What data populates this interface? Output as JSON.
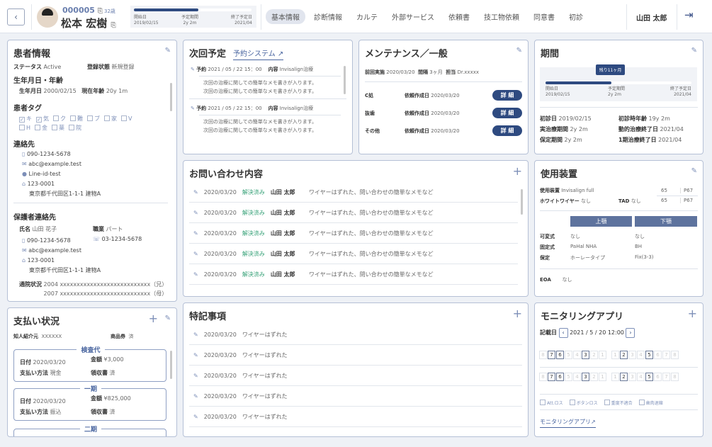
{
  "header": {
    "back": "‹",
    "patient_id": "000005",
    "age": "32歳",
    "name": "松本 宏樹",
    "progress": {
      "fraction": 0.55,
      "start_label": "開始日",
      "start": "2019/02/15",
      "period_label": "予定期間",
      "period": "2y 2m",
      "end_label": "終了予定日",
      "end": "2021/04"
    },
    "tabs": [
      "基本情報",
      "診断情報",
      "カルテ",
      "外部サービス",
      "依頼書",
      "技工物依頼",
      "同意書",
      "初診"
    ],
    "active_tab": "基本情報",
    "user": "山田 太郎"
  },
  "patient": {
    "title": "患者情報",
    "status_label": "ステータス",
    "status": "Active",
    "reg_label": "登録状態",
    "reg": "新規登録",
    "birth_title": "生年月日・年齢",
    "birth_label": "生年月日",
    "birth": "2000/02/15",
    "age_label": "現在年齢",
    "age": "20y 1m",
    "tags_title": "患者タグ",
    "tags": [
      {
        "label": "キ",
        "checked": true
      },
      {
        "label": "気",
        "checked": true
      },
      {
        "label": "ク",
        "checked": false
      },
      {
        "label": "難",
        "checked": false
      },
      {
        "label": "ブ",
        "checked": false
      },
      {
        "label": "家",
        "checked": false
      },
      {
        "label": "V",
        "checked": false
      },
      {
        "label": "H",
        "checked": false
      },
      {
        "label": "金",
        "checked": false
      },
      {
        "label": "薬",
        "checked": false
      },
      {
        "label": "院",
        "checked": false
      }
    ],
    "contact_title": "連絡先",
    "phone": "090-1234-5678",
    "email": "abc@example.test",
    "line": "Line-id-test",
    "zip": "123-0001",
    "address": "東京都千代田区1-1-1 建物A",
    "guardian_title": "保護者連絡先",
    "g_name_label": "氏名",
    "g_name": "山田 花子",
    "g_job_label": "職業",
    "g_job": "パート",
    "g_phone": "090-1234-5678",
    "g_tel": "03-1234-5678",
    "g_email": "abc@example.test",
    "g_zip": "123-0001",
    "g_address": "東京都千代田区1-1-1 建物A",
    "visit_label": "通院状況",
    "visits": [
      "2004 xxxxxxxxxxxxxxxxxxxxxxxxxxx（兄）",
      "2007 xxxxxxxxxxxxxxxxxxxxxxxxxxx（母）"
    ]
  },
  "payment": {
    "title": "支払い状況",
    "ref_label": "知人紹介元",
    "ref": "XXXXXX",
    "voucher_label": "商品券",
    "voucher": "済",
    "items": [
      {
        "title": "検査代",
        "date_label": "日付",
        "date": "2020/03/20",
        "amount_label": "金額",
        "amount": "¥3,000",
        "method_label": "支払い方法",
        "method": "現金",
        "receipt_label": "領収書",
        "receipt": "済"
      },
      {
        "title": "一期",
        "date_label": "日付",
        "date": "2020/03/20",
        "amount_label": "金額",
        "amount": "¥825,000",
        "method_label": "支払い方法",
        "method": "振込",
        "receipt_label": "領収書",
        "receipt": "済"
      },
      {
        "title": "二期"
      }
    ]
  },
  "next": {
    "title": "次回予定",
    "link": "予約システム",
    "items": [
      {
        "label": "予約",
        "datetime": "2021 / 05 / 22  15：00",
        "content_label": "内容",
        "content": "Invisalign治療",
        "memo1": "次回の治療に関しての簡単なメモ書きが入ります。",
        "memo2": "次回の治療に関しての簡単なメモ書きが入ります。"
      },
      {
        "label": "予約",
        "datetime": "2021 / 05 / 22  15：00",
        "content_label": "内容",
        "content": "Invisalign治療",
        "memo1": "次回の治療に関しての簡単なメモ書きが入ります。",
        "memo2": "次回の治療に関しての簡単なメモ書きが入ります。"
      }
    ]
  },
  "maint": {
    "title": "メンテナンス／一般",
    "last_label": "前回実施",
    "last": "2020/03/20",
    "interval_label": "間隔",
    "interval": "3ヶ月",
    "staff_label": "担当",
    "staff": "Dr.xxxxx",
    "rows": [
      {
        "name": "C処",
        "date_label": "依頼作成日",
        "date": "2020/03/20",
        "btn": "詳 細"
      },
      {
        "name": "抜歯",
        "date_label": "依頼作成日",
        "date": "2020/03/20",
        "btn": "詳 細"
      },
      {
        "name": "その他",
        "date_label": "依頼作成日",
        "date": "2020/03/20",
        "btn": "詳 細"
      }
    ]
  },
  "period": {
    "title": "期間",
    "remaining": "残り11ヶ月",
    "fraction": 0.45,
    "start_label": "開始日",
    "start": "2019/02/15",
    "plan_label": "予定期間",
    "plan": "2y 2m",
    "end_label": "終了予定日",
    "end": "2021/04",
    "first_label": "初診日",
    "first": "2019/02/15",
    "first_age_label": "初診時年齢",
    "first_age": "19y 2m",
    "actual_label": "実治療期間",
    "actual": "2y 2m",
    "active_end_label": "動的治療終了日",
    "active_end": "2021/04",
    "retain_label": "保定期間",
    "retain": "2y 2m",
    "p1_end_label": "1期治療終了日",
    "p1_end": "2021/04"
  },
  "inquiry": {
    "title": "お問い合わせ内容",
    "rows": [
      {
        "date": "2020/03/20",
        "status": "解決済み",
        "person": "山田 太郎",
        "text": "ワイヤーはずれた、問い合わせの簡単なメモなど"
      },
      {
        "date": "2020/03/20",
        "status": "解決済み",
        "person": "山田 太郎",
        "text": "ワイヤーはずれた、問い合わせの簡単なメモなど"
      },
      {
        "date": "2020/03/20",
        "status": "解決済み",
        "person": "山田 太郎",
        "text": "ワイヤーはずれた、問い合わせの簡単なメモなど"
      },
      {
        "date": "2020/03/20",
        "status": "解決済み",
        "person": "山田 太郎",
        "text": "ワイヤーはずれた、問い合わせの簡単なメモなど"
      },
      {
        "date": "2020/03/20",
        "status": "解決済み",
        "person": "山田 太郎",
        "text": "ワイヤーはずれた、問い合わせの簡単なメモなど"
      }
    ]
  },
  "device": {
    "title": "使用装置",
    "device_label": "使用装置",
    "device": "Invisalign full",
    "white_label": "ホワイトワイヤー",
    "white": "なし",
    "tad_label": "TAD",
    "tad": "なし",
    "n1": "65",
    "p1": "P67",
    "n2": "65",
    "p2": "P67",
    "upper": "上顎",
    "lower": "下顎",
    "rows": [
      {
        "label": "可変式",
        "upper": "なし",
        "lower": "なし"
      },
      {
        "label": "固定式",
        "upper": "PaHal NHA",
        "lower": "BH"
      },
      {
        "label": "保定",
        "upper": "ホーレータイプ",
        "lower": "Fix(3-3)"
      }
    ],
    "eoa_label": "EOA",
    "eoa": "なし"
  },
  "notes": {
    "title": "特記事項",
    "rows": [
      {
        "date": "2020/03/20",
        "text": "ワイヤーはずれた"
      },
      {
        "date": "2020/03/20",
        "text": "ワイヤーはずれた"
      },
      {
        "date": "2020/03/20",
        "text": "ワイヤーはずれた"
      },
      {
        "date": "2020/03/20",
        "text": "ワイヤーはずれた"
      },
      {
        "date": "2020/03/20",
        "text": "ワイヤーはずれた"
      }
    ]
  },
  "monitor": {
    "title": "モニタリングアプリ",
    "date_label": "記載日",
    "date": "2021 / 5 / 20  12:00",
    "teeth": [
      "8",
      "7",
      "6",
      "5",
      "4",
      "3",
      "2",
      "1",
      "1",
      "2",
      "3",
      "4",
      "5",
      "6",
      "7",
      "8"
    ],
    "highlight_left": [
      "7",
      "6",
      "3"
    ],
    "highlight_right": [
      "2",
      "5"
    ],
    "checks": [
      "Att.ロス",
      "ボタンロス",
      "重度不適合",
      "歯肉退縮"
    ],
    "link": "モニタリングアプリ"
  }
}
